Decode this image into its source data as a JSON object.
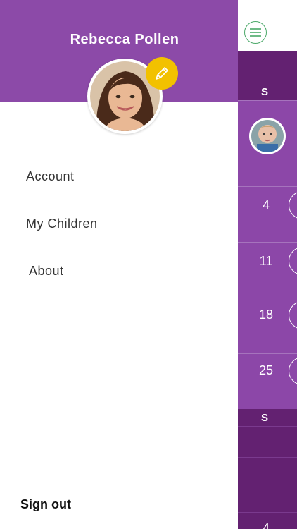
{
  "drawer": {
    "user_name": "Rebecca Pollen",
    "menu": [
      {
        "label": "Account"
      },
      {
        "label": "My Children"
      },
      {
        "label": "About"
      }
    ],
    "sign_out_label": "Sign out"
  },
  "calendar": {
    "day_headers": [
      "S",
      "S"
    ],
    "week_numbers": [
      "4",
      "11",
      "18",
      "25",
      "4"
    ]
  },
  "colors": {
    "drawer_header": "#8c4aa8",
    "calendar_purple": "#8c47a8",
    "calendar_dark": "#632171",
    "edit_button": "#f2c100",
    "menu_icon": "#4aa868"
  }
}
